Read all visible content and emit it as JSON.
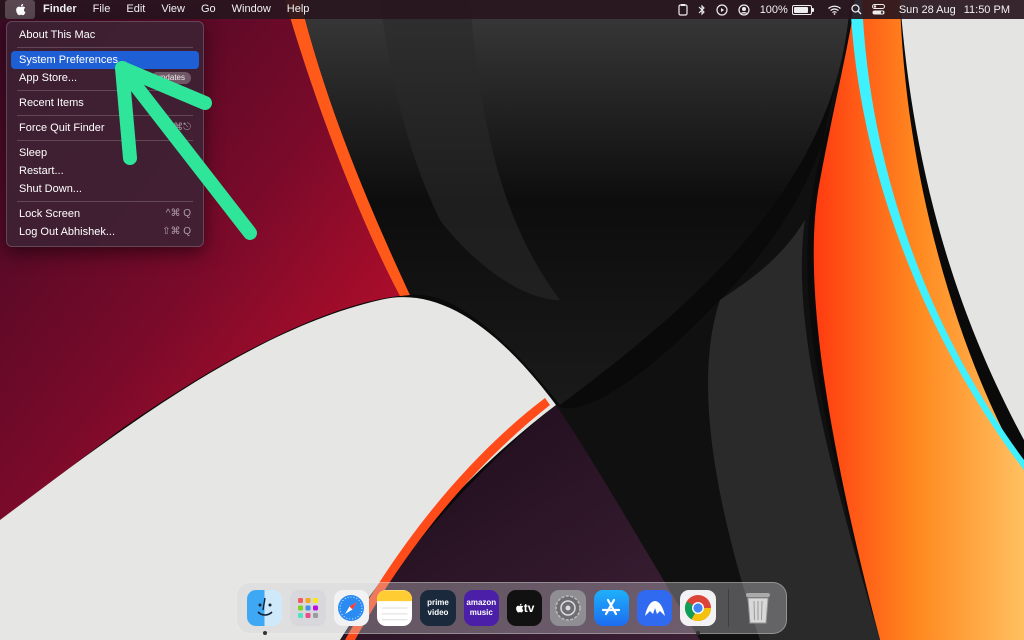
{
  "menubar": {
    "apple_icon": "apple-logo-icon",
    "items": [
      "Finder",
      "File",
      "Edit",
      "View",
      "Go",
      "Window",
      "Help"
    ],
    "status_icons": [
      "pasteboard-icon",
      "bluetooth-icon",
      "play-circle-icon",
      "user-circle-icon"
    ],
    "battery": "100%",
    "battery_level": 1.0,
    "right_icons": [
      "wifi-icon",
      "search-icon",
      "control-center-icon"
    ],
    "date": "Sun 28 Aug",
    "time": "11:50 PM"
  },
  "apple_menu": {
    "about": "About This Mac",
    "system_prefs": "System Preferences...",
    "app_store": "App Store...",
    "app_store_badge": "updates",
    "recent_items": "Recent Items",
    "force_quit": "Force Quit Finder",
    "force_quit_shortcut": "⌥⌘⎋",
    "sleep": "Sleep",
    "restart": "Restart...",
    "shut_down": "Shut Down...",
    "lock_screen": "Lock Screen",
    "lock_screen_shortcut": "^⌘ Q",
    "log_out": "Log Out Abhishek...",
    "log_out_shortcut": "⇧⌘ Q"
  },
  "annotation": {
    "arrow_color": "#2ee59a"
  },
  "dock": {
    "items": [
      {
        "name": "Finder",
        "icon": "finder-icon",
        "running": true
      },
      {
        "name": "Launchpad",
        "icon": "launchpad-icon",
        "running": false
      },
      {
        "name": "Safari",
        "icon": "safari-icon",
        "running": false
      },
      {
        "name": "Notes",
        "icon": "notes-icon",
        "running": false
      },
      {
        "name": "Prime Video",
        "icon": "prime-video-icon",
        "label": "prime video",
        "running": false
      },
      {
        "name": "Amazon Music",
        "icon": "amazon-music-icon",
        "label": "amazon music",
        "running": false
      },
      {
        "name": "Apple TV",
        "icon": "apple-tv-icon",
        "label": "tv",
        "running": false
      },
      {
        "name": "System Preferences",
        "icon": "system-preferences-icon",
        "running": false
      },
      {
        "name": "App Store",
        "icon": "app-store-icon",
        "running": false
      },
      {
        "name": "NordVPN",
        "icon": "nordvpn-icon",
        "running": false
      },
      {
        "name": "Google Chrome",
        "icon": "chrome-icon",
        "running": true
      },
      {
        "name": "Trash",
        "icon": "trash-icon",
        "running": false
      }
    ]
  }
}
